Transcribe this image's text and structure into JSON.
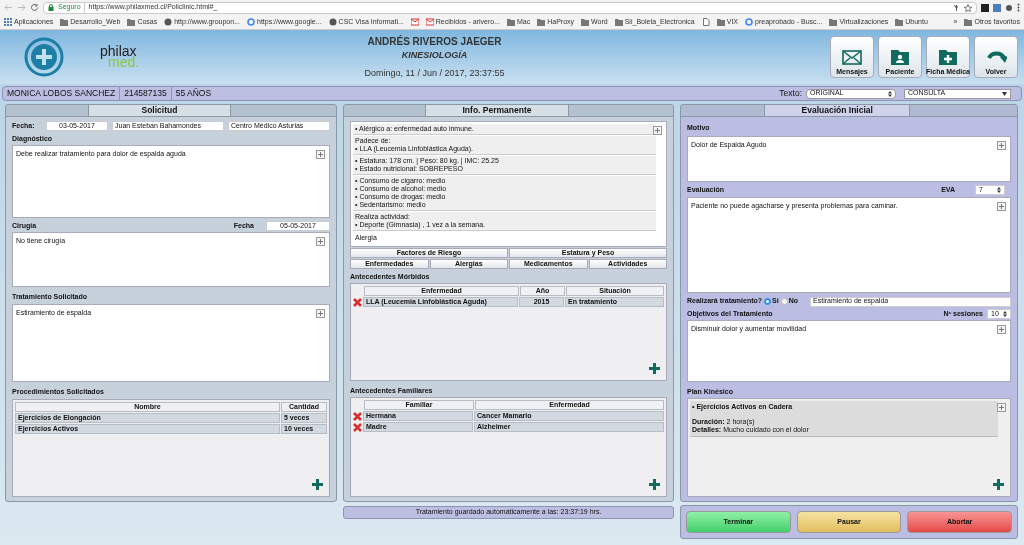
{
  "browser": {
    "secure_label": "Seguro",
    "url": "https://www.philaxmed.cl/Policlinic.html#_",
    "bookmarks": [
      {
        "kind": "apps",
        "label": "Aplicaciones"
      },
      {
        "kind": "folder",
        "label": "Desarrollo_Web"
      },
      {
        "kind": "folder",
        "label": "Cosas"
      },
      {
        "kind": "site",
        "label": "http://www.groupon..."
      },
      {
        "kind": "google",
        "label": "https://www.google..."
      },
      {
        "kind": "site",
        "label": "CSC Visa Informati..."
      },
      {
        "kind": "mail"
      },
      {
        "kind": "mail",
        "label": "Recibidos - arivero..."
      },
      {
        "kind": "folder",
        "label": "Mac"
      },
      {
        "kind": "folder",
        "label": "HaProxy"
      },
      {
        "kind": "folder",
        "label": "Word"
      },
      {
        "kind": "folder",
        "label": "Sii_Boleta_Electronica"
      },
      {
        "kind": "page"
      },
      {
        "kind": "folder",
        "label": "VIX"
      },
      {
        "kind": "google",
        "label": "preaprobado - Busc..."
      },
      {
        "kind": "folder",
        "label": "Virtualizaciones"
      },
      {
        "kind": "folder",
        "label": "Ubuntu"
      }
    ],
    "more": "»",
    "other_bookmarks": "Otros favoritos"
  },
  "header": {
    "logo_top": "philax",
    "logo_bottom": "med.",
    "professional": "ANDRÉS RIVEROS JAEGER",
    "specialty": "KINESIOLOGÍA",
    "datetime": "Domingo, 11 / Jun / 2017, 23:37:55",
    "actions": [
      {
        "kind": "mail",
        "label": "Mensajes"
      },
      {
        "kind": "patient",
        "label": "Paciente"
      },
      {
        "kind": "record",
        "label": "Ficha Médica"
      },
      {
        "kind": "back",
        "label": "Volver"
      }
    ]
  },
  "patient_bar": {
    "name": "MONICA LOBOS SANCHEZ",
    "id": "214587135",
    "age": "55 AÑOS",
    "texto_label": "Texto:",
    "texto_select": "ORIGINAL",
    "type_select": "CONSULTA"
  },
  "solicitud": {
    "title": "Solicitud",
    "fecha_label": "Fecha:",
    "fecha": "03-05-2017",
    "profesional": "Juan Esteban Bahamondes",
    "centro": "Centro Médico Asturias",
    "diagnostico_label": "Diagnóstico",
    "diagnostico": "Debe realizar tratamiento para dolor de espalda aguda",
    "cirugia_label": "Cirugía",
    "cirugia_fecha_label": "Fecha",
    "cirugia_fecha": "05-05-2017",
    "cirugia": "No tiene cirugía",
    "tratamiento_label": "Tratamiento Solicitado",
    "tratamiento": "Estiramiento de espalda",
    "procedimientos_label": "Procedimientos Solicitados",
    "columns": [
      "Nombre",
      "Cantidad"
    ],
    "rows": [
      [
        "Ejercicios de Elongación",
        "5 veces"
      ],
      [
        "Ejercicios Activos",
        "10 veces"
      ]
    ]
  },
  "info": {
    "title": "Info. Permanente",
    "blocks": [
      [
        "• Alérgico a: enfermedad auto inmune."
      ],
      [
        "Padece de:",
        "• LLA (Leucemia Linfoblástica Aguda)."
      ],
      [
        "• Estatura: 178 cm. | Peso: 80 kg. | IMC: 25.25",
        "• Estado nutricional: SOBREPESO"
      ],
      [
        "• Consumo de cigarro: medio",
        "• Consumo de alcohol: medio",
        "• Consumo de drogas: medio",
        "• Sedentarismo: medio"
      ],
      [
        "Realiza actividad:",
        "• Deporte (Gimnasia) , 1 vez a la semana."
      ]
    ],
    "alergia": "Alergia",
    "button_rows": [
      [
        "Factores de Riesgo",
        "Estatura y Peso"
      ],
      [
        "Enfermedades",
        "Alergias",
        "Medicamentos",
        "Actividades"
      ]
    ],
    "morbidos_label": "Antecedentes Mórbidos",
    "morbidos_columns": [
      "Enfermedad",
      "Año",
      "Situación"
    ],
    "morbidos_rows": [
      [
        "LLA (Leucemia Linfoblástica Aguda)",
        "2015",
        "En tratamiento"
      ]
    ],
    "familiares_label": "Antecedentes Familiares",
    "familiares_columns": [
      "Familiar",
      "Enfermedad"
    ],
    "familiares_rows": [
      [
        "Hermana",
        "Cancer Mamario"
      ],
      [
        "Madre",
        "Alzheimer"
      ]
    ]
  },
  "evaluacion": {
    "title": "Evaluación Inicial",
    "motivo_label": "Motivo",
    "motivo": "Dolor de Espalda Agudo",
    "evaluacion_label": "Evaluación",
    "eva_label": "EVA",
    "eva": "7",
    "evaluacion": "Paciente no puede agacharse y presenta problemas para caminar.",
    "realizara_label": "Realizará tratamiento?",
    "options": [
      {
        "label": "Sí",
        "selected": true
      },
      {
        "label": "No",
        "selected": false
      }
    ],
    "tratamiento": "Estiramiento de espalda",
    "objetivos_label": "Objetivos del Tratamiento",
    "sesiones_label": "Nº sesiones",
    "sesiones": "10",
    "objetivos": "Disminuir dolor y aumentar movilidad",
    "plan_label": "Plan Kinésico",
    "plan": [
      {
        "title": "• Ejercicios Activos en Cadera",
        "duracion_label": "Duración:",
        "duracion": "2 hora(s)",
        "detalles_label": "Detalles:",
        "detalles": "Mucho cuidado con el dolor"
      }
    ]
  },
  "status": "Tratamiento guardado automáticamente a las: 23:37:19 hrs.",
  "buttons": [
    {
      "kind": "green",
      "label": "Terminar"
    },
    {
      "kind": "yellow",
      "label": "Pausar"
    },
    {
      "kind": "red",
      "label": "Abortar"
    }
  ]
}
